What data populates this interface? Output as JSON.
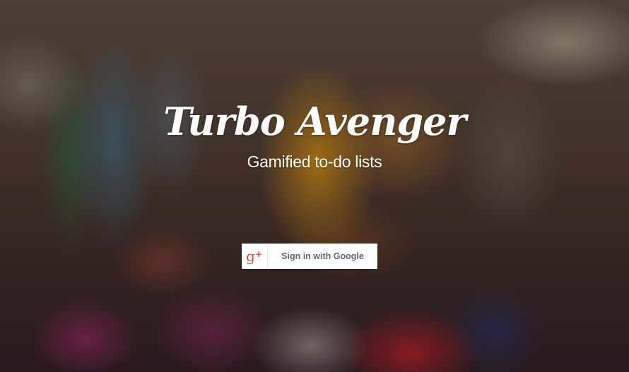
{
  "app": {
    "title": "Turbo Avenger",
    "tagline": "Gamified to-do lists"
  },
  "signin": {
    "label": "Sign in with Google",
    "icon": "google-plus-icon",
    "icon_color": "#dd4b39"
  }
}
